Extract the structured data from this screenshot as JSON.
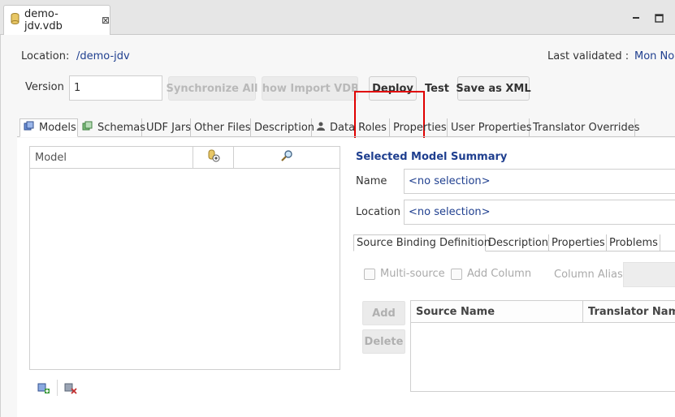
{
  "editor_tab": {
    "title": "demo-jdv.vdb"
  },
  "header": {
    "location_label": "Location:",
    "location_value": "/demo-jdv",
    "last_validated_label": "Last validated :",
    "last_validated_value": "Mon No",
    "version_label": "Version",
    "version_value": "1"
  },
  "toolbar": {
    "synchronize_all": "Synchronize All",
    "show_import_vdbs": "Show Import VDBs",
    "deploy": "Deploy",
    "test": "Test",
    "save_as_xml": "Save as XML"
  },
  "subtabs": [
    "Models",
    "Schemas",
    "UDF Jars",
    "Other Files",
    "Description",
    "Data Roles",
    "Properties",
    "User Properties",
    "Translator Overrides"
  ],
  "model_table": {
    "col_model": "Model"
  },
  "summary": {
    "title": "Selected Model Summary",
    "name_label": "Name",
    "name_value": "<no selection>",
    "location_label": "Location",
    "location_value": "<no selection>"
  },
  "inner_tabs": [
    "Source Binding Definition",
    "Description",
    "Properties",
    "Problems"
  ],
  "binding": {
    "multi_source": "Multi-source",
    "add_column": "Add Column",
    "column_alias": "Column Alias",
    "add": "Add",
    "delete": "Delete",
    "col_source_name": "Source Name",
    "col_translator_name": "Translator Name"
  }
}
